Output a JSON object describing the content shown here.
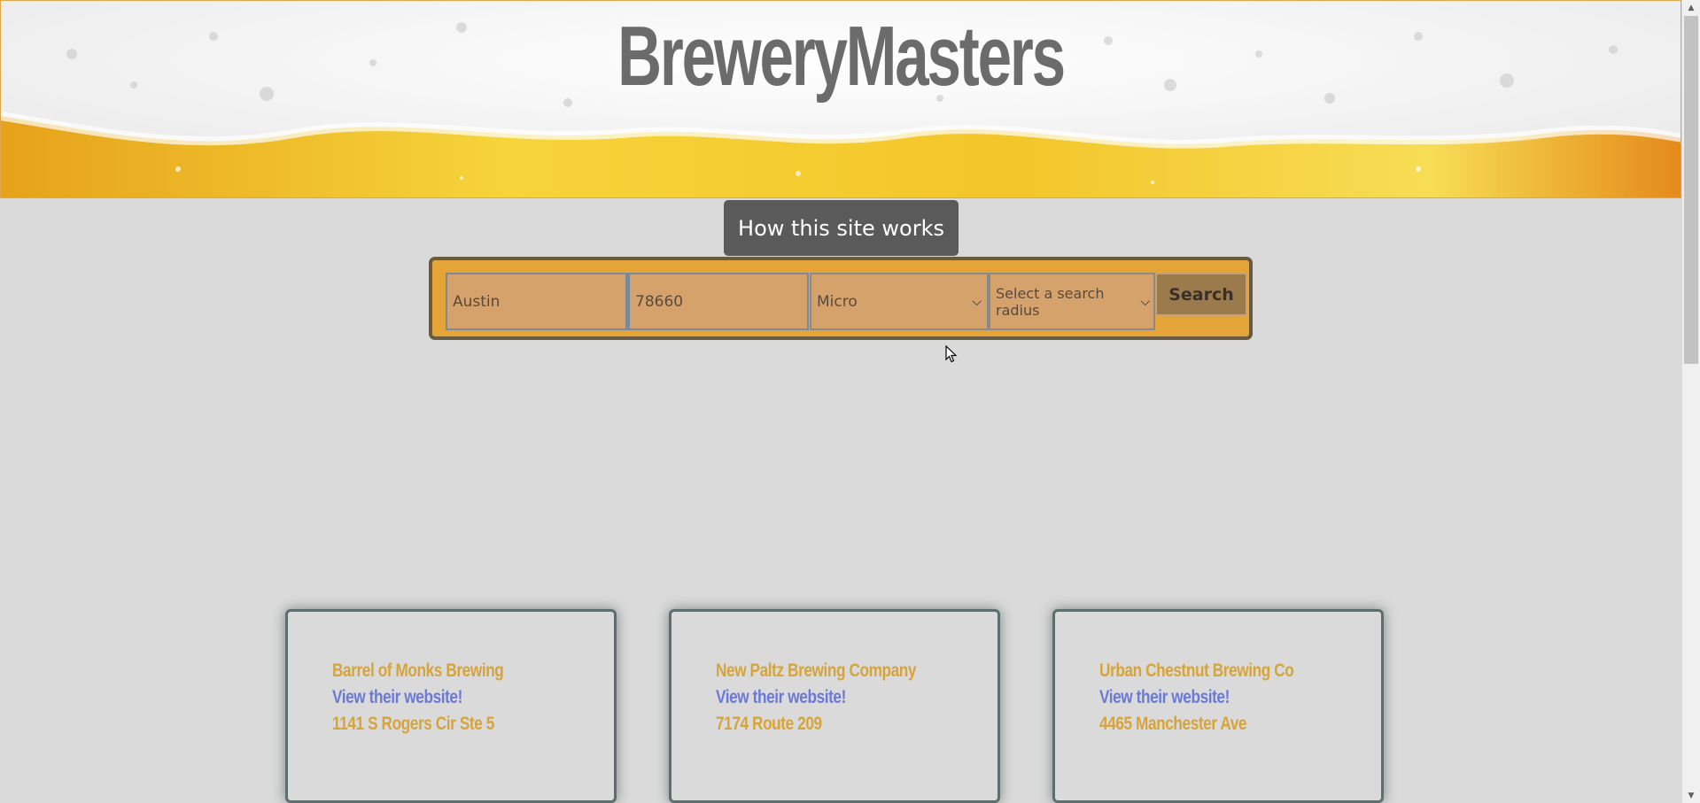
{
  "header": {
    "title": "BreweryMasters"
  },
  "how_button": {
    "label": "How this site works"
  },
  "search": {
    "city_value": "Austin",
    "zip_value": "78660",
    "type_value": "Micro",
    "radius_placeholder": "Select a search radius",
    "button_label": "Search"
  },
  "cards": [
    {
      "name": "Barrel of Monks Brewing",
      "link": "View their website!",
      "address": "1141 S Rogers Cir Ste 5"
    },
    {
      "name": "New Paltz Brewing Company",
      "link": "View their website!",
      "address": "7174 Route 209"
    },
    {
      "name": "Urban Chestnut Brewing Co",
      "link": "View their website!",
      "address": "4465 Manchester Ave"
    }
  ],
  "colors": {
    "accent": "#e5a437",
    "title": "#6b6b6b",
    "card_name": "#d6a439",
    "card_link": "#6b7ad6"
  }
}
